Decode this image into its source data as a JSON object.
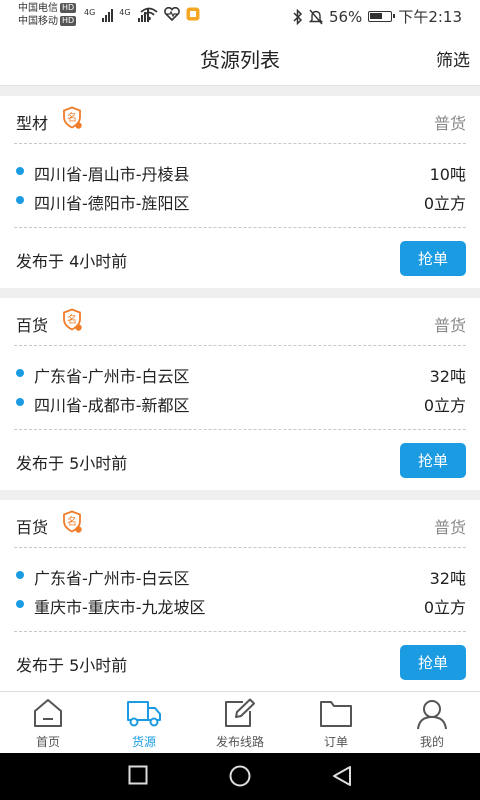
{
  "status_bar": {
    "carrier1": "中国电信",
    "carrier2": "中国移动",
    "hd": "HD",
    "net1": "4G",
    "net2": "4G",
    "battery_percent": "56%",
    "time": "下午2:13"
  },
  "header": {
    "title": "货源列表",
    "filter_label": "筛选"
  },
  "cards": [
    {
      "name": "型材",
      "type": "普货",
      "routes": [
        {
          "place": "四川省-眉山市-丹棱县",
          "amount": "10吨"
        },
        {
          "place": "四川省-德阳市-旌阳区",
          "amount": "0立方"
        }
      ],
      "published": "发布于 4小时前",
      "action_label": "抢单"
    },
    {
      "name": "百货",
      "type": "普货",
      "routes": [
        {
          "place": "广东省-广州市-白云区",
          "amount": "32吨"
        },
        {
          "place": "四川省-成都市-新都区",
          "amount": "0立方"
        }
      ],
      "published": "发布于 5小时前",
      "action_label": "抢单"
    },
    {
      "name": "百货",
      "type": "普货",
      "routes": [
        {
          "place": "广东省-广州市-白云区",
          "amount": "32吨"
        },
        {
          "place": "重庆市-重庆市-九龙坡区",
          "amount": "0立方"
        }
      ],
      "published": "发布于 5小时前",
      "action_label": "抢单"
    }
  ],
  "badge_glyph": "名",
  "tabbar": {
    "items": [
      {
        "label": "首页",
        "icon": "home-icon",
        "active": false
      },
      {
        "label": "货源",
        "icon": "truck-icon",
        "active": true
      },
      {
        "label": "发布线路",
        "icon": "edit-icon",
        "active": false
      },
      {
        "label": "订单",
        "icon": "folder-icon",
        "active": false
      },
      {
        "label": "我的",
        "icon": "user-icon",
        "active": false
      }
    ]
  },
  "colors": {
    "accent": "#1a9be2",
    "badge": "#f07c2a",
    "text": "#222222",
    "muted": "#888888"
  }
}
